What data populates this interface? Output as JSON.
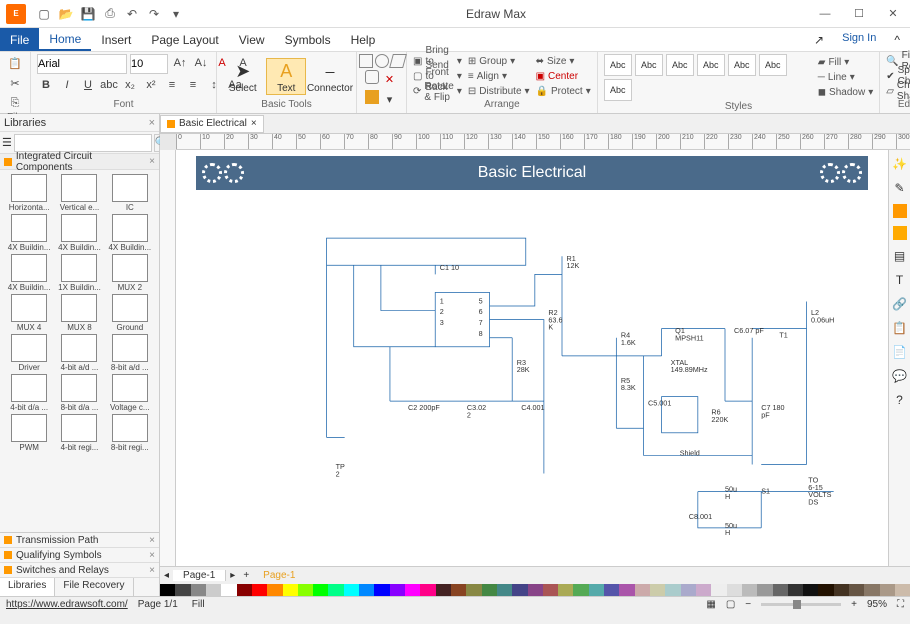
{
  "app": {
    "title": "Edraw Max"
  },
  "qat": [
    "new",
    "open",
    "save",
    "print",
    "undo",
    "redo"
  ],
  "winbtns": {
    "min": "—",
    "max": "☐",
    "close": "✕"
  },
  "menu": {
    "file": "File",
    "items": [
      "Home",
      "Insert",
      "Page Layout",
      "View",
      "Symbols",
      "Help"
    ],
    "active": "Home",
    "signin": "Sign In",
    "share": "↗"
  },
  "ribbon": {
    "file_group": "File",
    "font": {
      "label": "Font",
      "family": "Arial",
      "size": "10",
      "buttons": [
        "B",
        "I",
        "U",
        "abc",
        "x₂",
        "x²",
        "≡",
        "≡",
        "≡",
        "Aa"
      ],
      "top_buttons": [
        "A↑",
        "A↓",
        "A",
        "A"
      ]
    },
    "tools": {
      "label": "Basic Tools",
      "select": "Select",
      "text": "Text",
      "connector": "Connector"
    },
    "arrange": {
      "label": "Arrange",
      "items": [
        "Bring to Front",
        "Send to Back",
        "Rotate & Flip",
        "Group",
        "Align",
        "Distribute",
        "Size",
        "Center",
        "Protect"
      ]
    },
    "styles": {
      "label": "Styles",
      "box": "Abc",
      "fill": "Fill",
      "line": "Line",
      "shadow": "Shadow"
    },
    "editing": {
      "label": "Editing",
      "find": "Find & Replace",
      "spell": "Spelling Check",
      "change": "Change Shape"
    }
  },
  "libraries": {
    "title": "Libraries",
    "search_placeholder": "",
    "category": "Integrated Circuit Components",
    "items": [
      [
        "Horizonta...",
        "Vertical e...",
        "IC"
      ],
      [
        "4X Buildin...",
        "4X Buildin...",
        "4X Buildin..."
      ],
      [
        "4X Buildin...",
        "1X Buildin...",
        "MUX 2"
      ],
      [
        "MUX 4",
        "MUX 8",
        "Ground"
      ],
      [
        "Driver",
        "4-bit a/d ...",
        "8-bit a/d ..."
      ],
      [
        "4-bit d/a ...",
        "8-bit d/a ...",
        "Voltage c..."
      ],
      [
        "PWM",
        "4-bit regi...",
        "8-bit regi..."
      ]
    ],
    "other_cats": [
      "Transmission Path",
      "Qualifying Symbols",
      "Switches and Relays"
    ],
    "tabs": {
      "lib": "Libraries",
      "rec": "File Recovery"
    }
  },
  "document": {
    "tab": "Basic Electrical",
    "banner": "Basic Electrical",
    "page_tab": "Page-1",
    "page_tab2": "Page-1",
    "components": {
      "C1": "C1 10",
      "R1": "R1\n12K",
      "R2": "R2\n63.6\nK",
      "R3": "R3\n28K",
      "C2": "C2 200pF",
      "C3": "C3.02\n2",
      "C4": "C4.001",
      "R4": "R4\n1.6K",
      "R5": "R5\n8.3K",
      "C5": "C5.001",
      "Q1": "Q1\nMPSH11",
      "XTAL": "XTAL\n149.89MHz",
      "R6": "R6\n220K",
      "C6": "C6.07 pF",
      "T1": "T1",
      "L2": "L2\n0.06uH",
      "C7": "C7 180\npF",
      "Shield": "Shield",
      "TP": "TP\n2",
      "L50a": "50u\nH",
      "L50b": "50u\nH",
      "C8": "C8.001",
      "S1": "S1",
      "OUT": "TO\n6-15\nVOLTS\nDS",
      "pins": "1     5\n2     6\n3     7\n       8"
    }
  },
  "ruler_ticks": [
    "0",
    "10",
    "20",
    "30",
    "40",
    "50",
    "60",
    "70",
    "80",
    "90",
    "100",
    "110",
    "120",
    "130",
    "140",
    "150",
    "160",
    "170",
    "180",
    "190",
    "200",
    "210",
    "220",
    "230",
    "240",
    "250",
    "260",
    "270",
    "280",
    "290",
    "300"
  ],
  "status": {
    "url": "https://www.edrawsoft.com/",
    "page": "Page 1/1",
    "fill": "Fill",
    "zoom": "95%"
  },
  "palette": [
    "#000",
    "#444",
    "#888",
    "#ccc",
    "#fff",
    "#800",
    "#f00",
    "#f80",
    "#ff0",
    "#8f0",
    "#0f0",
    "#0f8",
    "#0ff",
    "#08f",
    "#00f",
    "#80f",
    "#f0f",
    "#f08",
    "#422",
    "#842",
    "#884",
    "#484",
    "#488",
    "#448",
    "#848",
    "#a55",
    "#aa5",
    "#5a5",
    "#5aa",
    "#55a",
    "#a5a",
    "#caa",
    "#cca",
    "#acc",
    "#aac",
    "#cac",
    "#eee",
    "#ddd",
    "#bbb",
    "#999",
    "#666",
    "#333",
    "#111",
    "#210",
    "#432",
    "#654",
    "#876",
    "#a98",
    "#cba"
  ]
}
